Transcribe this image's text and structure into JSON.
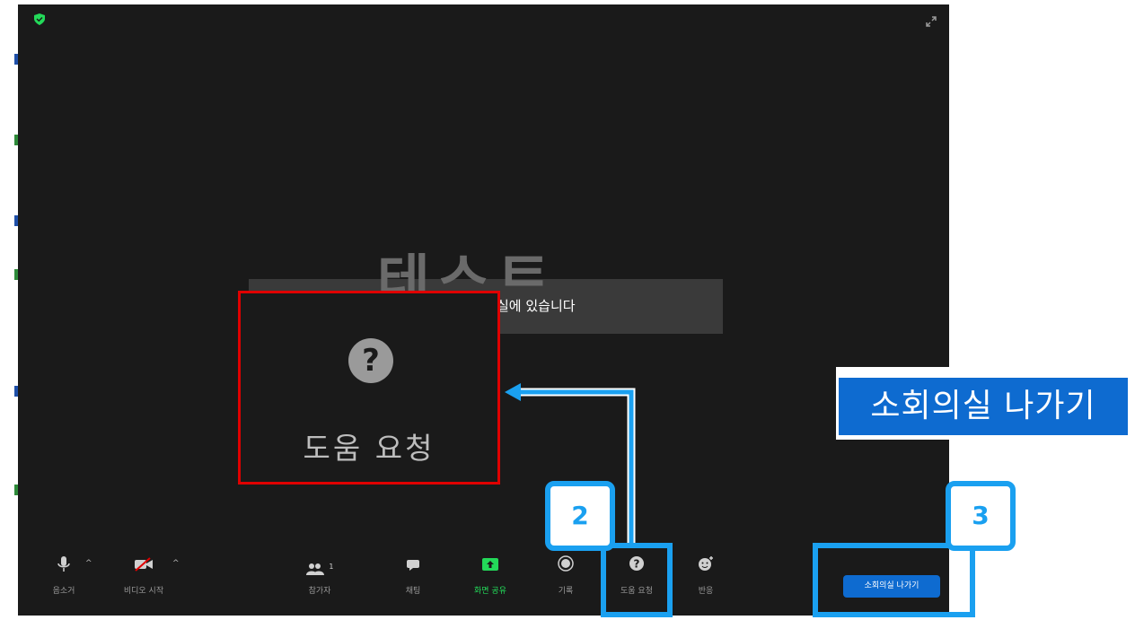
{
  "participant": {
    "name": "테스트",
    "status": "실에 있습니다"
  },
  "help_popup": {
    "icon": "question-circle-icon",
    "label": "도움 요청"
  },
  "callouts": {
    "exit_breakout_label": "소회의실 나가기",
    "step_2": "2",
    "step_3": "3"
  },
  "toolbar": {
    "mute_label": "음소거",
    "video_label": "비디오 시작",
    "participants_label": "참가자",
    "participants_count": "1",
    "chat_label": "채팅",
    "share_label": "화면 공유",
    "record_label": "기록",
    "help_label": "도움 요청",
    "reactions_label": "반응",
    "exit_breakout_label": "소회의실 나가기"
  },
  "colors": {
    "accent_blue": "#0e6bd0",
    "callout_blue": "#1aa0f0",
    "highlight_red": "#e00000",
    "share_green": "#23d959",
    "security_green": "#23d959"
  }
}
